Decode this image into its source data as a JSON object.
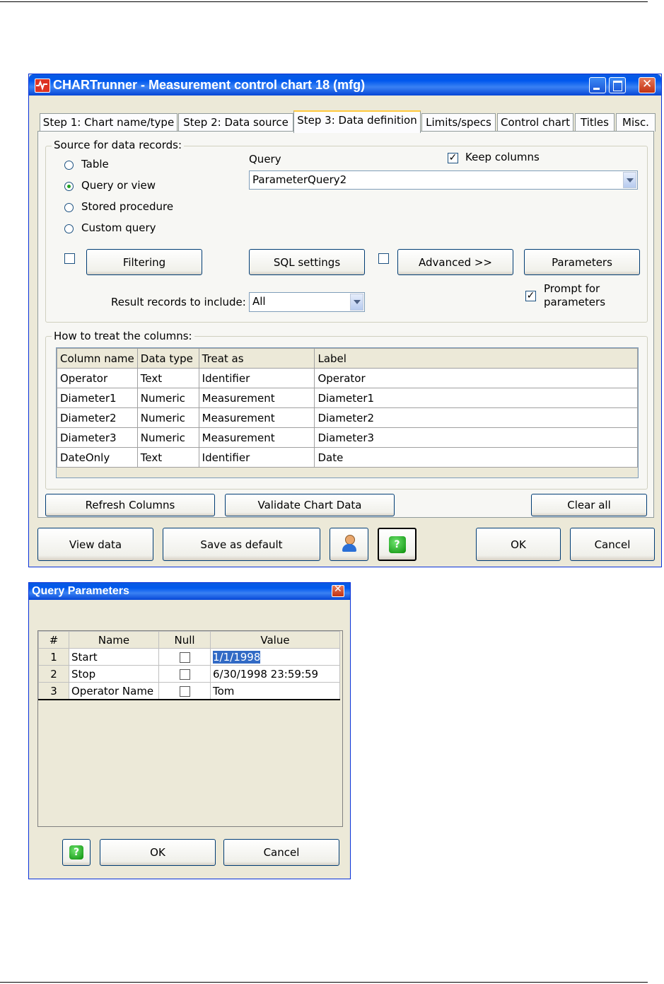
{
  "main_window": {
    "title": "CHARTrunner - Measurement control chart 18 (mfg)",
    "tabs": [
      {
        "label": "Step 1: Chart name/type"
      },
      {
        "label": "Step 2: Data source"
      },
      {
        "label": "Step 3: Data definition"
      },
      {
        "label": "Limits/specs"
      },
      {
        "label": "Control chart"
      },
      {
        "label": "Titles"
      },
      {
        "label": "Misc."
      }
    ],
    "active_tab": "Step 3: Data definition",
    "source_group": {
      "legend": "Source for data records:",
      "options": [
        {
          "label": "Table",
          "selected": false
        },
        {
          "label": "Query or view",
          "selected": true
        },
        {
          "label": "Stored procedure",
          "selected": false
        },
        {
          "label": "Custom query",
          "selected": false
        }
      ],
      "query_label": "Query",
      "query_value": "ParameterQuery2",
      "keep_columns_label": "Keep columns",
      "keep_columns_checked": true,
      "filtering_label": "Filtering",
      "sql_settings_label": "SQL settings",
      "advanced_label": "Advanced >>",
      "parameters_label": "Parameters",
      "result_records_label": "Result records to include:",
      "result_records_value": "All",
      "prompt_line1": "Prompt for",
      "prompt_line2": "parameters",
      "prompt_checked": true
    },
    "columns_group": {
      "legend": "How to treat the columns:",
      "headers": [
        "Column name",
        "Data type",
        "Treat as",
        "Label"
      ],
      "rows": [
        [
          "Operator",
          "Text",
          "Identifier",
          "Operator"
        ],
        [
          "Diameter1",
          "Numeric",
          "Measurement",
          "Diameter1"
        ],
        [
          "Diameter2",
          "Numeric",
          "Measurement",
          "Diameter2"
        ],
        [
          "Diameter3",
          "Numeric",
          "Measurement",
          "Diameter3"
        ],
        [
          "DateOnly",
          "Text",
          "Identifier",
          "Date"
        ]
      ]
    },
    "refresh_columns_label": "Refresh Columns",
    "validate_label": "Validate Chart Data",
    "clear_all_label": "Clear all",
    "bottom_buttons": {
      "view_data": "View data",
      "save_default": "Save as default",
      "ok": "OK",
      "cancel": "Cancel"
    }
  },
  "query_params": {
    "title": "Query Parameters",
    "headers": [
      "#",
      "Name",
      "Null",
      "Value"
    ],
    "rows": [
      {
        "num": "1",
        "name": "Start",
        "null": false,
        "value": "1/1/1998"
      },
      {
        "num": "2",
        "name": "Stop",
        "null": false,
        "value": "6/30/1998 23:59:59"
      },
      {
        "num": "3",
        "name": "Operator Name",
        "null": false,
        "value": "Tom"
      }
    ],
    "ok_label": "OK",
    "cancel_label": "Cancel"
  }
}
